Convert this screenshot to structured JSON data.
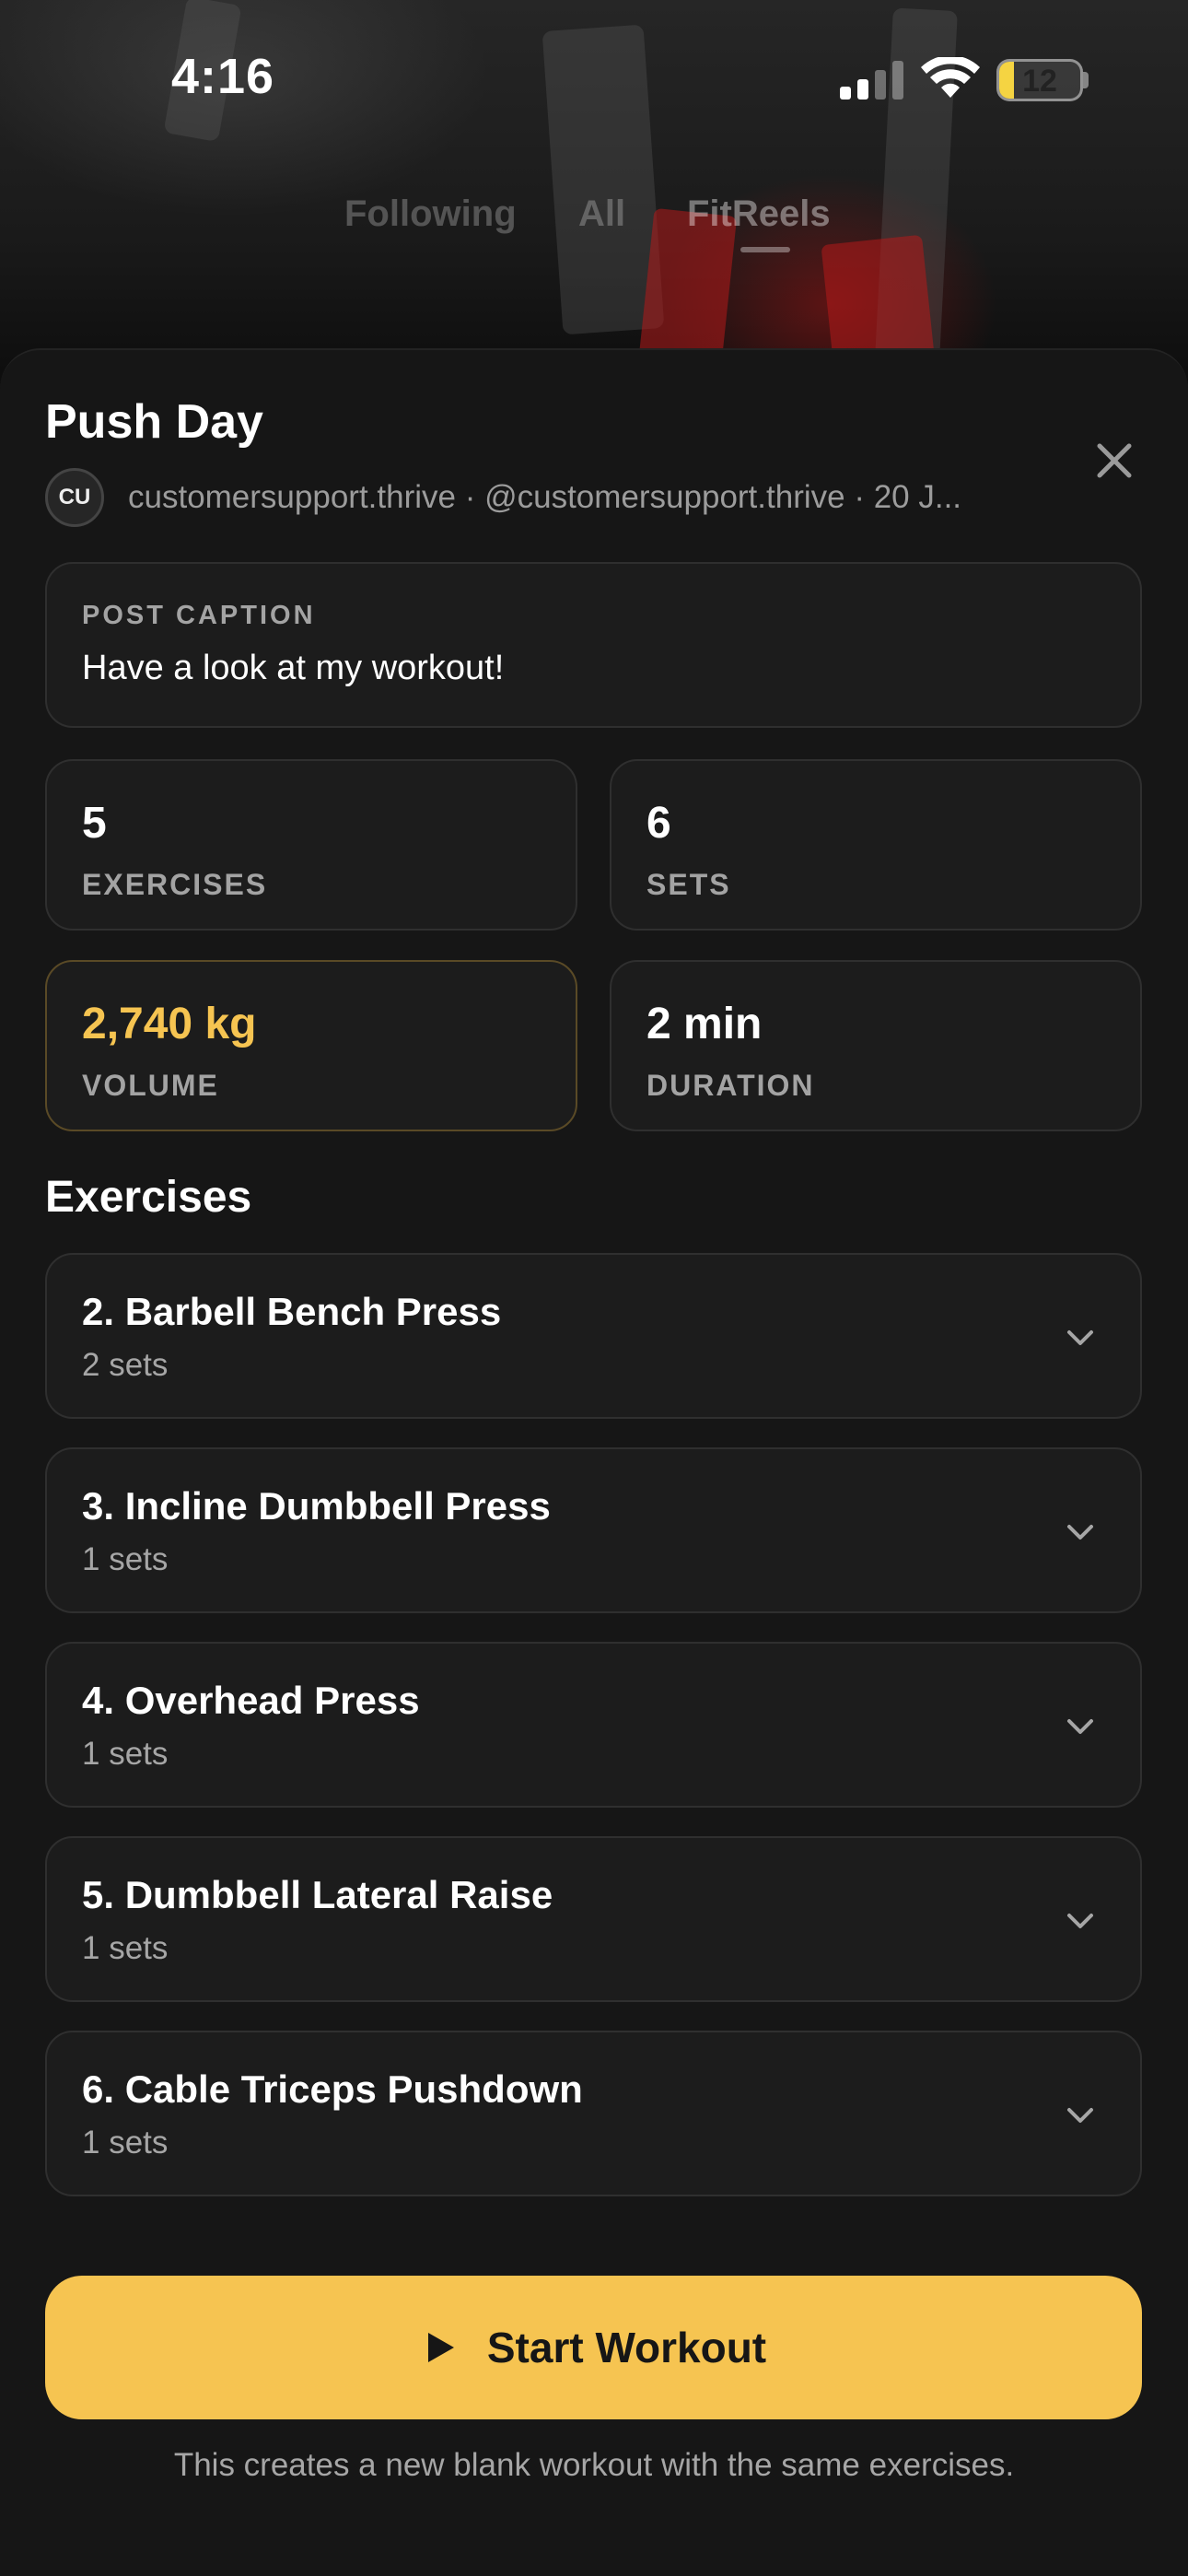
{
  "status_bar": {
    "time": "4:16",
    "battery_level": "12",
    "battery_fill": 0.12,
    "battery_color": "#f5d442"
  },
  "feed_tabs": [
    {
      "label": "Following",
      "active": false
    },
    {
      "label": "All",
      "active": false
    },
    {
      "label": "FitReels",
      "active": true
    }
  ],
  "workout": {
    "title": "Push Day",
    "avatar_initials": "CU",
    "author_meta": "customersupport.thrive · @customersupport.thrive · 20 J...",
    "close_icon": "close-icon"
  },
  "caption": {
    "label": "POST CAPTION",
    "text": "Have a look at my workout!"
  },
  "stats": [
    {
      "value": "5",
      "label": "EXERCISES",
      "highlight": false
    },
    {
      "value": "6",
      "label": "SETS",
      "highlight": false
    },
    {
      "value": "2,740 kg",
      "label": "VOLUME",
      "highlight": true
    },
    {
      "value": "2 min",
      "label": "DURATION",
      "highlight": false
    }
  ],
  "exercises_section": {
    "title": "Exercises",
    "items": [
      {
        "name": "2. Barbell Bench Press",
        "sets": "2 sets"
      },
      {
        "name": "3. Incline Dumbbell Press",
        "sets": "1 sets"
      },
      {
        "name": "4. Overhead Press",
        "sets": "1 sets"
      },
      {
        "name": "5. Dumbbell Lateral Raise",
        "sets": "1 sets"
      },
      {
        "name": "6. Cable Triceps Pushdown",
        "sets": "1 sets"
      }
    ]
  },
  "actions": {
    "start_label": "Start Workout",
    "start_icon": "play-icon",
    "start_note": "This creates a new blank workout with the same exercises."
  },
  "colors": {
    "accent": "#f6c451",
    "background": "#161616",
    "card": "#1c1c1c"
  }
}
